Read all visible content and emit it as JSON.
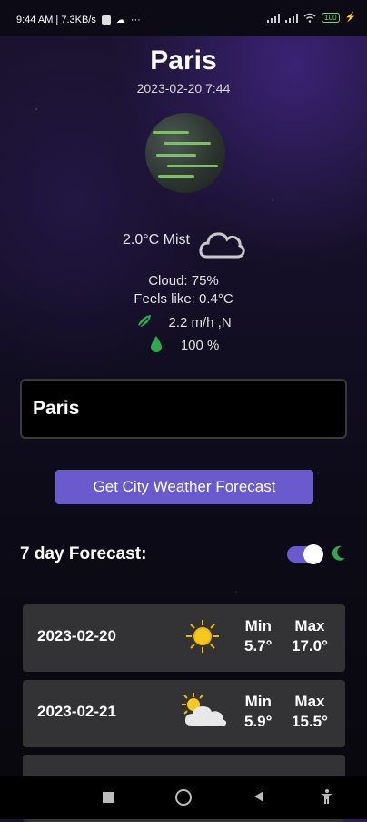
{
  "status_bar": {
    "time_speed": "9:44 AM | 7.3KB/s",
    "dots": "···",
    "battery": "100"
  },
  "city_name": "Paris",
  "datetime": "2023-02-20 7:44",
  "current": {
    "temp_desc": "2.0°C  Mist",
    "cloud": "Cloud: 75%",
    "feels_like": "Feels like: 0.4°C",
    "wind": "2.2 m/h ,N",
    "humidity": "100 %"
  },
  "search": {
    "value": "Paris"
  },
  "get_button_label": "Get City Weather Forecast",
  "forecast_title": "7 day Forecast:",
  "forecast": [
    {
      "date": "2023-02-20",
      "min_label": "Min",
      "max_label": "Max",
      "min": "5.7°",
      "max": "17.0°",
      "icon": "sun-icon"
    },
    {
      "date": "2023-02-21",
      "min_label": "Min",
      "max_label": "Max",
      "min": "5.9°",
      "max": "15.5°",
      "icon": "partly-cloudy-icon"
    }
  ],
  "colors": {
    "accent": "#6a5acd",
    "card": "#333235",
    "green": "#2fa84f"
  }
}
